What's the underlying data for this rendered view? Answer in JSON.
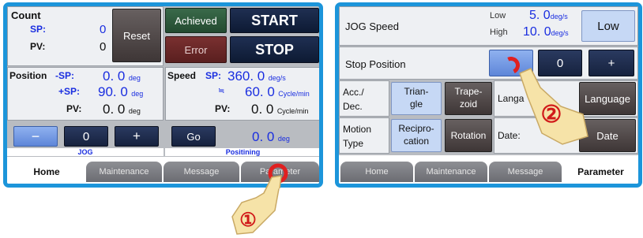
{
  "home": {
    "count": {
      "title": "Count",
      "sp_label": "SP:",
      "sp_value": "0",
      "pv_label": "PV:",
      "pv_value": "0",
      "reset": "Reset"
    },
    "status": {
      "achieved": "Achieved",
      "error": "Error",
      "start": "START",
      "stop": "STOP"
    },
    "position": {
      "title": "Position",
      "minus_sp_label": "-SP:",
      "minus_sp_value": "0. 0",
      "plus_sp_label": "+SP:",
      "plus_sp_value": "90. 0",
      "pv_label": "PV:",
      "pv_value": "0. 0",
      "unit": "deg"
    },
    "speed": {
      "title": "Speed",
      "sp_label": "SP:",
      "sp_value": "360. 0",
      "sp_unit": "deg/s",
      "approx": "≒",
      "approx_value": "60. 0",
      "approx_unit": "Cycle/min",
      "pv_label": "PV:",
      "pv_value": "0. 0",
      "pv_unit": "Cycle/min"
    },
    "jog": {
      "minus": "−",
      "value": "0",
      "plus": "+",
      "label": "JOG"
    },
    "positioning": {
      "go": "Go",
      "value": "0. 0",
      "unit": "deg",
      "label": "Positining"
    },
    "tabs": [
      "Home",
      "Maintenance",
      "Message",
      "Parameter"
    ]
  },
  "parameter": {
    "jog_speed": {
      "label": "JOG Speed",
      "low_label": "Low",
      "low_value": "5. 0",
      "high_label": "High",
      "high_value": "10. 0",
      "unit": "deg/s",
      "button": "Low"
    },
    "stop_position": {
      "label": "Stop Position",
      "value": "0",
      "plus": "+"
    },
    "acc_dec": {
      "label_line1": "Acc./",
      "label_line2": "Dec.",
      "opt1_line1": "Trian-",
      "opt1_line2": "gle",
      "opt2_line1": "Trape-",
      "opt2_line2": "zoid"
    },
    "motion_type": {
      "label_line1": "Motion",
      "label_line2": "Type",
      "opt1_line1": "Recipro-",
      "opt1_line2": "cation",
      "opt2": "Rotation"
    },
    "language": {
      "label": "Langa",
      "button": "Language"
    },
    "date": {
      "label": "Date:",
      "button": "Date"
    },
    "tabs": [
      "Home",
      "Maintenance",
      "Message",
      "Parameter"
    ]
  },
  "annotations": {
    "step1": "①",
    "step2": "②"
  },
  "colors": {
    "frame": "#1c95da",
    "cursor_ring": "#e02020",
    "hand": "#f6e3a8"
  }
}
